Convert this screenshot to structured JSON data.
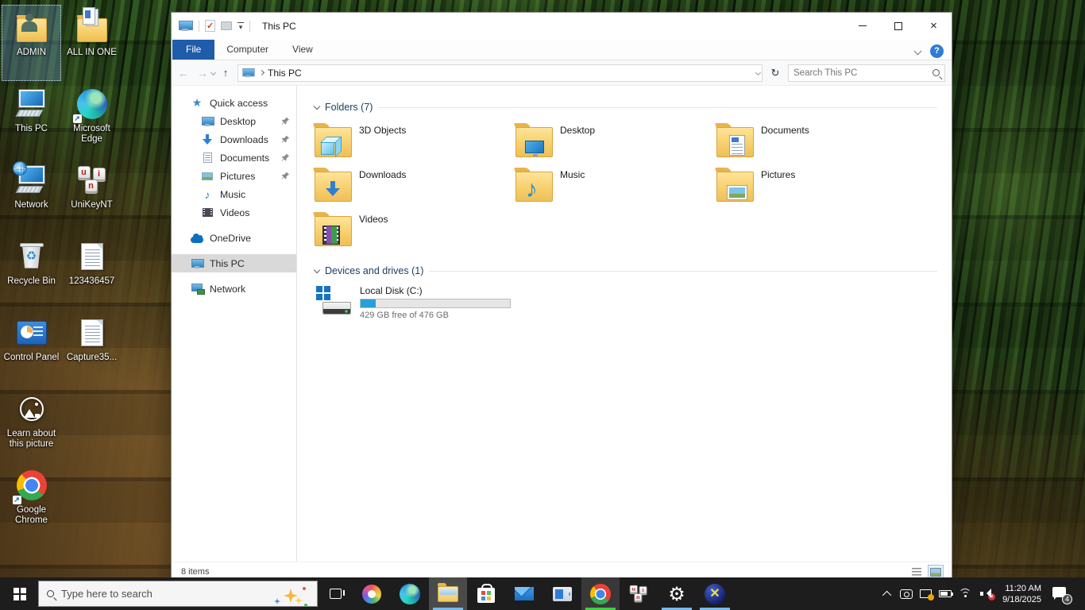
{
  "explorer": {
    "title": "This PC",
    "tabs": [
      {
        "label": "File"
      },
      {
        "label": "Computer"
      },
      {
        "label": "View"
      }
    ],
    "breadcrumb": "This PC",
    "search_placeholder": "Search This PC",
    "nav": {
      "items": [
        {
          "label": "Quick access"
        },
        {
          "label": "Desktop",
          "pinned": true
        },
        {
          "label": "Downloads",
          "pinned": true
        },
        {
          "label": "Documents",
          "pinned": true
        },
        {
          "label": "Pictures",
          "pinned": true
        },
        {
          "label": "Music"
        },
        {
          "label": "Videos"
        },
        {
          "label": "OneDrive"
        },
        {
          "label": "This PC",
          "selected": true
        },
        {
          "label": "Network"
        }
      ]
    },
    "folders": {
      "title": "Folders (7)",
      "items": [
        {
          "name": "3D Objects"
        },
        {
          "name": "Desktop"
        },
        {
          "name": "Documents"
        },
        {
          "name": "Downloads"
        },
        {
          "name": "Music"
        },
        {
          "name": "Pictures"
        },
        {
          "name": "Videos"
        }
      ]
    },
    "drives": {
      "title": "Devices and drives (1)",
      "drive": {
        "name": "Local Disk (C:)",
        "free": "429 GB free of 476 GB",
        "used_percent": 10
      }
    },
    "status": {
      "count": "8 items"
    }
  },
  "desktop": {
    "icons": [
      {
        "label": "ADMIN",
        "icon": "user-folder",
        "selected": true
      },
      {
        "label": "This PC",
        "icon": "computer"
      },
      {
        "label": "Network",
        "icon": "network-computer"
      },
      {
        "label": "Recycle Bin",
        "icon": "recycle-bin"
      },
      {
        "label": "Control Panel",
        "icon": "control-panel"
      },
      {
        "label": "Learn about this picture",
        "icon": "spotlight"
      },
      {
        "label": "Google Chrome",
        "icon": "chrome"
      },
      {
        "label": "ALL IN ONE",
        "icon": "documents-folder"
      },
      {
        "label": "Microsoft Edge",
        "icon": "edge"
      },
      {
        "label": "UniKeyNT",
        "icon": "unikey"
      },
      {
        "label": "123436457",
        "icon": "text-document"
      },
      {
        "label": "Capture35...",
        "icon": "text-document"
      }
    ]
  },
  "taskbar": {
    "search_placeholder": "Type here to search",
    "apps": [
      {
        "name": "copilot"
      },
      {
        "name": "edge"
      },
      {
        "name": "file-explorer",
        "state": "active"
      },
      {
        "name": "store"
      },
      {
        "name": "mail"
      },
      {
        "name": "app-window"
      },
      {
        "name": "chrome",
        "state": "open-green"
      },
      {
        "name": "unikey"
      },
      {
        "name": "settings",
        "state": "open"
      },
      {
        "name": "app-x",
        "state": "open"
      }
    ],
    "tray": {
      "time": "11:20 AM",
      "date": "9/18/2025",
      "notification_count": "4"
    }
  },
  "colors": {
    "accent": "#0078d7",
    "file_tab": "#1f5ca9",
    "underline_blue": "#76b9ed",
    "underline_green": "#3ecf3e",
    "disk_used": "#26a0da"
  }
}
